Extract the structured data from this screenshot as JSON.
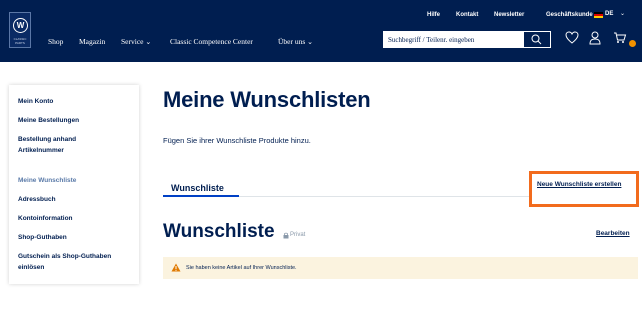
{
  "colors": {
    "header_bg": "#001e50",
    "accent_orange": "#f26b1d",
    "notice_bg": "#fbf3df",
    "tab_active": "#0040c5"
  },
  "header": {
    "utility_links": [
      "Hilfe",
      "Kontakt",
      "Newsletter",
      "Geschäftskunde"
    ],
    "language": "DE",
    "nav": [
      {
        "label": "Shop",
        "has_dropdown": false
      },
      {
        "label": "Magazin",
        "has_dropdown": false
      },
      {
        "label": "Service",
        "has_dropdown": true
      },
      {
        "label": "Classic Competence Center",
        "has_dropdown": false
      },
      {
        "label": "Über uns",
        "has_dropdown": true
      }
    ],
    "search_placeholder": "Suchbegriff / Teilenr. eingeben",
    "icons": [
      "search-icon",
      "heart-icon",
      "user-icon",
      "cart-icon"
    ]
  },
  "sidebar": {
    "items": [
      {
        "label": "Mein Konto",
        "active": false
      },
      {
        "label": "Meine Bestellungen",
        "active": false
      },
      {
        "label": "Bestellung anhand Artikelnummer",
        "active": false
      },
      {
        "label": "Meine Wunschliste",
        "active": true
      },
      {
        "label": "Adressbuch",
        "active": false
      },
      {
        "label": "Kontoinformation",
        "active": false
      },
      {
        "label": "Shop-Guthaben",
        "active": false
      },
      {
        "label": "Gutschein als Shop-Guthaben einlösen",
        "active": false
      }
    ]
  },
  "main": {
    "title": "Meine Wunschlisten",
    "subtitle": "Fügen Sie ihrer Wunschliste Produkte hinzu.",
    "tab_label": "Wunschliste",
    "new_list_label": "Neue Wunschliste erstellen",
    "list_title": "Wunschliste",
    "privacy_label": "Privat",
    "edit_label": "Bearbeiten",
    "notice_text": "Sie haben keine Artikel auf Ihrer Wunschliste."
  }
}
